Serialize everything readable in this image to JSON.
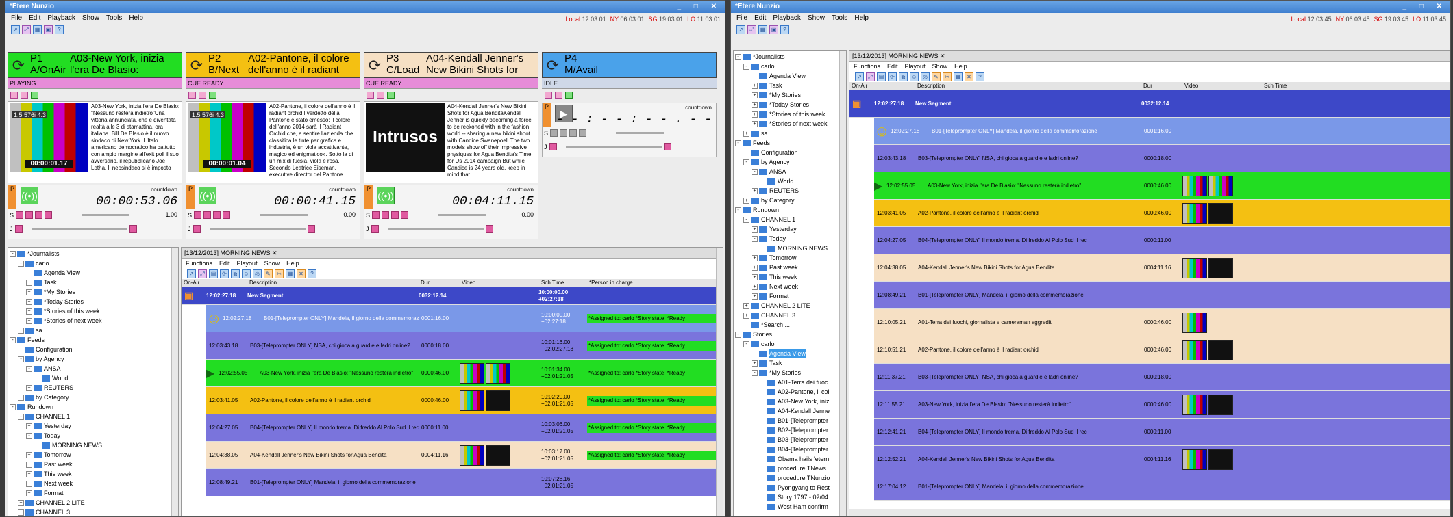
{
  "app": {
    "title": "*Etere Nunzio"
  },
  "menu": [
    "File",
    "Edit",
    "Playback",
    "Show",
    "Tools",
    "Help"
  ],
  "clocks": {
    "left": [
      {
        "city": "Local",
        "time": "12:03:01"
      },
      {
        "city": "NY",
        "time": "06:03:01"
      },
      {
        "city": "SG",
        "time": "19:03:01"
      },
      {
        "city": "LO",
        "time": "11:03:01"
      }
    ],
    "right": [
      {
        "city": "Local",
        "time": "12:03:45"
      },
      {
        "city": "NY",
        "time": "06:03:45"
      },
      {
        "city": "SG",
        "time": "19:03:45"
      },
      {
        "city": "LO",
        "time": "11:03:45"
      }
    ]
  },
  "channels": [
    {
      "id": "P1",
      "state_line": "A/OnAir",
      "title": "A03-New York, inizia l'era De Blasio:",
      "status": "PLAYING",
      "tc": "00:00:01.17",
      "fmt": "1.5  576i 4:3",
      "desc": "A03-New York, inizia l'era De Blasio: \"Nessuno resterà indietro\"Una vittoria annunciata, che è diventata realtà alle 3 di stamattina, ora italiana. Bill De Blasio è il nuovo sindaco di New York. L'Italo americano democratico ha battutto con ampio margine all'exit poll il suo avversario, il repubblicano Joe Lotha. Il neosindaco si è imposto",
      "countdown": "00:00:53.06",
      "rate": "1.00",
      "color": "#22dd22"
    },
    {
      "id": "P2",
      "state_line": "B/Next",
      "title": "A02-Pantone, il colore dell'anno è il radiant",
      "status": "CUE READY",
      "tc": "00:00:01.04",
      "fmt": "1.5  576i 4:3",
      "desc": "A02-Pantone, il colore dell'anno è il radiant orchidIl verdetto della Pantone è stato emesso: il colore dell'anno 2014 sarà il Radiant Orchid che, a sentire l'azienda che classifica le tinte per grafica e industria, è un viola accattivante, magico ed enigmatico». Sotto la di un mix di fucsia, viola e rosa. Secondo Leatrice Eiseman, executive director del Pantone",
      "countdown": "00:00:41.15",
      "rate": "0.00",
      "color": "#f4c012"
    },
    {
      "id": "P3",
      "state_line": "C/Load",
      "title": "A04-Kendall Jenner's New Bikini Shots for",
      "status": "CUE READY",
      "tc": "",
      "fmt": "",
      "desc": "A04-Kendall Jenner's New Bikini Shots for Agua BenditaKendall Jenner is quickly becoming a force to be reckoned with in the fashion world -- sharing a new bikini shoot with Candice Swanepoel. The two models show off their impressive physiques for Agua Bendita's Time for Us 2014 campaign But while Candice is 24 years old, keep in mind that",
      "countdown": "00:04:11.15",
      "rate": "0.00",
      "color": "#f6e0c4"
    },
    {
      "id": "P4",
      "state_line": "M/Avail",
      "title": "",
      "status": "IDLE",
      "countdown": "- - : - - : - - . - -",
      "rate": "",
      "color": "#4aa2ea"
    }
  ],
  "intrusos": "Intrusos",
  "countdown_label": "countdown",
  "doc_tab": "[13/12/2013] MORNING NEWS",
  "rundown_menu": [
    "Functions",
    "Edit",
    "Playout",
    "Show",
    "Help"
  ],
  "grid_headers": {
    "onair": "On-Air",
    "desc": "Description",
    "dur": "Dur",
    "video": "Video",
    "sch": "Sch Time",
    "person": "*Person in charge"
  },
  "rows_left": [
    {
      "time": "12:02:27.18",
      "desc": "New Segment",
      "dur": "0032:12.14",
      "sch": "10:00:00.00 +02:27:18",
      "cls": "rh",
      "asg": ""
    },
    {
      "time": "12:02:27.18",
      "desc": "B01-[Teleprompter ONLY] Mandela, il giorno della commemorazione",
      "dur": "0001:16.00",
      "sch": "10:00:00.00 +02:27:18",
      "cls": "rs",
      "asg": "*Assigned to: carlo *Story state: *Ready",
      "smile": true
    },
    {
      "time": "12:03:43.18",
      "desc": "B03-[Teleprompter ONLY] NSA, chi gioca a guardie e ladri online?",
      "dur": "0000:18.00",
      "sch": "10:01:16.00 +02:02:27.18",
      "cls": "rp",
      "asg": "*Assigned to: carlo *Story state: *Ready"
    },
    {
      "time": "12:02:55.05",
      "desc": "A03-New York, inizia l'era De Blasio: \"Nessuno resterà indietro\"",
      "dur": "0000:46.00",
      "sch": "10:01:34.00 +02:01:21.05",
      "cls": "rg",
      "asg": "*Assigned to: carlo *Story state: *Ready",
      "vid": 2
    },
    {
      "time": "12:03:41.05",
      "desc": "A02-Pantone, il colore dell'anno è il radiant orchid",
      "dur": "0000:46.00",
      "sch": "10:02:20.00 +02:01:21.05",
      "cls": "ry",
      "asg": "*Assigned to: carlo *Story state: *Ready",
      "vid": 2
    },
    {
      "time": "12:04:27.05",
      "desc": "B04-[Teleprompter ONLY] Il mondo trema. Di freddo Al Polo Sud il rec",
      "dur": "0000:11.00",
      "sch": "10:03:06.00 +02:01:21.05",
      "cls": "rp",
      "asg": "*Assigned to: carlo *Story state: *Ready"
    },
    {
      "time": "12:04:38.05",
      "desc": "A04-Kendall Jenner's New Bikini Shots for Agua Bendita",
      "dur": "0004:11.16",
      "sch": "10:03:17.00 +02:01:21.05",
      "cls": "rt",
      "asg": "*Assigned to: carlo *Story state: *Ready",
      "vid": 2
    },
    {
      "time": "12:08:49.21",
      "desc": "B01-[Teleprompter ONLY] Mandela, il giorno della commemorazione",
      "dur": "",
      "sch": "10:07:28.16 +02:01:21.05",
      "cls": "rp",
      "asg": ""
    }
  ],
  "rows_right": [
    {
      "time": "12:02:27.18",
      "desc": "New Segment",
      "dur": "0032:12.14",
      "cls": "rh"
    },
    {
      "time": "12:02:27.18",
      "desc": "B01-[Teleprompter ONLY] Mandela, il giorno della commemorazione",
      "dur": "0001:16.00",
      "cls": "rs",
      "smile": true
    },
    {
      "time": "12:03:43.18",
      "desc": "B03-[Teleprompter ONLY] NSA, chi gioca a guardie e ladri online?",
      "dur": "0000:18.00",
      "cls": "rp"
    },
    {
      "time": "12:02:55.05",
      "desc": "A03-New York, inizia l'era De Blasio: \"Nessuno resterà indietro\"",
      "dur": "0000:46.00",
      "cls": "rg",
      "vid": 2
    },
    {
      "time": "12:03:41.05",
      "desc": "A02-Pantone, il colore dell'anno è il radiant orchid",
      "dur": "0000:46.00",
      "cls": "ry",
      "vid": 2
    },
    {
      "time": "12:04:27.05",
      "desc": "B04-[Teleprompter ONLY] Il mondo trema. Di freddo Al Polo Sud il rec",
      "dur": "0000:11.00",
      "cls": "rp"
    },
    {
      "time": "12:04:38.05",
      "desc": "A04-Kendall Jenner's New Bikini Shots for Agua Bendita",
      "dur": "0004:11.16",
      "cls": "rt",
      "vid": 2
    },
    {
      "time": "12:08:49.21",
      "desc": "B01-[Teleprompter ONLY] Mandela, il giorno della commemorazione",
      "dur": "",
      "cls": "rp"
    },
    {
      "time": "12:10:05.21",
      "desc": "A01-Terra dei fuochi, giornalista e cameraman aggrediti",
      "dur": "0000:46.00",
      "cls": "rt",
      "vid": 1
    },
    {
      "time": "12:10:51.21",
      "desc": "A02-Pantone, il colore dell'anno è il radiant orchid",
      "dur": "0000:46.00",
      "cls": "rt",
      "vid": 2
    },
    {
      "time": "12:11:37.21",
      "desc": "B03-[Teleprompter ONLY] NSA, chi gioca a guardie e ladri online?",
      "dur": "0000:18.00",
      "cls": "rp"
    },
    {
      "time": "12:11:55.21",
      "desc": "A03-New York, inizia l'era De Blasio: \"Nessuno resterà indietro\"",
      "dur": "0000:46.00",
      "cls": "rp",
      "vid": 2
    },
    {
      "time": "12:12:41.21",
      "desc": "B04-[Teleprompter ONLY] Il mondo trema. Di freddo Al Polo Sud il rec",
      "dur": "0000:11.00",
      "cls": "rp"
    },
    {
      "time": "12:12:52.21",
      "desc": "A04-Kendall Jenner's New Bikini Shots for Agua Bendita",
      "dur": "0004:11.16",
      "cls": "rp",
      "vid": 2
    },
    {
      "time": "12:17:04.12",
      "desc": "B01-[Teleprompter ONLY] Mandela, il giorno della commemorazione",
      "dur": "",
      "cls": "rp"
    }
  ],
  "tree_left": [
    {
      "d": 0,
      "t": "*Journalists",
      "ex": "-"
    },
    {
      "d": 1,
      "t": "carlo",
      "ex": "-"
    },
    {
      "d": 2,
      "t": "Agenda View"
    },
    {
      "d": 2,
      "t": "Task",
      "ex": "+"
    },
    {
      "d": 2,
      "t": "*My Stories",
      "ex": "+"
    },
    {
      "d": 2,
      "t": "*Today Stories",
      "ex": "+"
    },
    {
      "d": 2,
      "t": "*Stories of this week",
      "ex": "+"
    },
    {
      "d": 2,
      "t": "*Stories of next week",
      "ex": "+"
    },
    {
      "d": 1,
      "t": "sa",
      "ex": "+"
    },
    {
      "d": 0,
      "t": "Feeds",
      "ex": "-"
    },
    {
      "d": 1,
      "t": "Configuration"
    },
    {
      "d": 1,
      "t": "by Agency",
      "ex": "-"
    },
    {
      "d": 2,
      "t": "ANSA",
      "ex": "-"
    },
    {
      "d": 3,
      "t": "World"
    },
    {
      "d": 2,
      "t": "REUTERS",
      "ex": "+"
    },
    {
      "d": 1,
      "t": "by Category",
      "ex": "+"
    },
    {
      "d": 0,
      "t": "Rundown",
      "ex": "-"
    },
    {
      "d": 1,
      "t": "CHANNEL 1",
      "ex": "-"
    },
    {
      "d": 2,
      "t": "Yesterday",
      "ex": "+"
    },
    {
      "d": 2,
      "t": "Today",
      "ex": "-"
    },
    {
      "d": 3,
      "t": "MORNING NEWS"
    },
    {
      "d": 2,
      "t": "Tomorrow",
      "ex": "+"
    },
    {
      "d": 2,
      "t": "Past week",
      "ex": "+"
    },
    {
      "d": 2,
      "t": "This week",
      "ex": "+"
    },
    {
      "d": 2,
      "t": "Next week",
      "ex": "+"
    },
    {
      "d": 2,
      "t": "Format",
      "ex": "+"
    },
    {
      "d": 1,
      "t": "CHANNEL 2 LITE",
      "ex": "+"
    },
    {
      "d": 1,
      "t": "CHANNEL 3",
      "ex": "+"
    }
  ],
  "tree_right": [
    {
      "d": 0,
      "t": "*Journalists",
      "ex": "-"
    },
    {
      "d": 1,
      "t": "carlo",
      "ex": "-"
    },
    {
      "d": 2,
      "t": "Agenda View"
    },
    {
      "d": 2,
      "t": "Task",
      "ex": "+"
    },
    {
      "d": 2,
      "t": "*My Stories",
      "ex": "+"
    },
    {
      "d": 2,
      "t": "*Today Stories",
      "ex": "+"
    },
    {
      "d": 2,
      "t": "*Stories of this week",
      "ex": "+"
    },
    {
      "d": 2,
      "t": "*Stories of next week",
      "ex": "+"
    },
    {
      "d": 1,
      "t": "sa",
      "ex": "+"
    },
    {
      "d": 0,
      "t": "Feeds",
      "ex": "-"
    },
    {
      "d": 1,
      "t": "Configuration"
    },
    {
      "d": 1,
      "t": "by Agency",
      "ex": "-"
    },
    {
      "d": 2,
      "t": "ANSA",
      "ex": "-"
    },
    {
      "d": 3,
      "t": "World"
    },
    {
      "d": 2,
      "t": "REUTERS",
      "ex": "+"
    },
    {
      "d": 1,
      "t": "by Category",
      "ex": "+"
    },
    {
      "d": 0,
      "t": "Rundown",
      "ex": "-"
    },
    {
      "d": 1,
      "t": "CHANNEL 1",
      "ex": "-"
    },
    {
      "d": 2,
      "t": "Yesterday",
      "ex": "+"
    },
    {
      "d": 2,
      "t": "Today",
      "ex": "-"
    },
    {
      "d": 3,
      "t": "MORNING NEWS"
    },
    {
      "d": 2,
      "t": "Tomorrow",
      "ex": "+"
    },
    {
      "d": 2,
      "t": "Past week",
      "ex": "+"
    },
    {
      "d": 2,
      "t": "This week",
      "ex": "+"
    },
    {
      "d": 2,
      "t": "Next week",
      "ex": "+"
    },
    {
      "d": 2,
      "t": "Format",
      "ex": "+"
    },
    {
      "d": 1,
      "t": "CHANNEL 2 LITE",
      "ex": "+"
    },
    {
      "d": 1,
      "t": "CHANNEL 3",
      "ex": "+"
    },
    {
      "d": 1,
      "t": "*Search ..."
    },
    {
      "d": 0,
      "t": "Stories",
      "ex": "-"
    },
    {
      "d": 1,
      "t": "carlo",
      "ex": "-"
    },
    {
      "d": 2,
      "t": "Agenda View",
      "sel": true
    },
    {
      "d": 2,
      "t": "Task",
      "ex": "+"
    },
    {
      "d": 2,
      "t": "*My Stories",
      "ex": "-"
    },
    {
      "d": 3,
      "t": "A01-Terra dei fuoc"
    },
    {
      "d": 3,
      "t": "A02-Pantone, il col"
    },
    {
      "d": 3,
      "t": "A03-New York, inizi"
    },
    {
      "d": 3,
      "t": "A04-Kendall Jenne"
    },
    {
      "d": 3,
      "t": "B01-[Teleprompter"
    },
    {
      "d": 3,
      "t": "B02-[Teleprompter"
    },
    {
      "d": 3,
      "t": "B03-[Teleprompter"
    },
    {
      "d": 3,
      "t": "B04-[Teleprompter"
    },
    {
      "d": 3,
      "t": "Obama hails 'etern"
    },
    {
      "d": 3,
      "t": "procedure TNews"
    },
    {
      "d": 3,
      "t": "procedure TNunzio"
    },
    {
      "d": 3,
      "t": "Pyongyang to Rest"
    },
    {
      "d": 3,
      "t": "Story 1797 - 02/04"
    },
    {
      "d": 3,
      "t": "West Ham confirm"
    }
  ]
}
